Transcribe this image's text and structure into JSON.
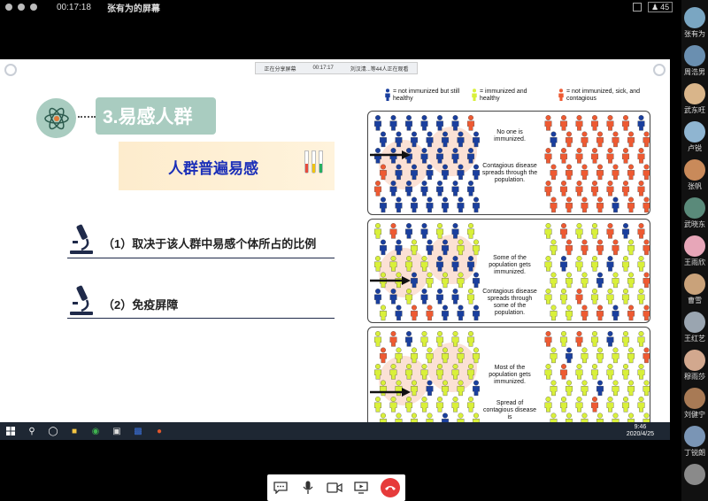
{
  "topbar": {
    "timer": "00:17:18",
    "sharer": "张有为的屏幕",
    "participant_count": "45"
  },
  "share_banner": {
    "status": "正在分享屏幕",
    "time": "00:17:17",
    "viewers": "刘汉清...等44人正在观看"
  },
  "slide": {
    "title": "3.易感人群",
    "subtitle": "人群普遍易感",
    "points": [
      "（1）取决于该人群中易感个体所占的比例",
      "（2）免疫屏障"
    ],
    "figure": {
      "legend": [
        {
          "text": "= not immunized but still healthy",
          "color": "#1a3f9e"
        },
        {
          "text": "= immunized and healthy",
          "color": "#d9f03a"
        },
        {
          "text": "= not immunized, sick, and contagious",
          "color": "#ee5a32"
        }
      ],
      "panels": [
        {
          "caption_top": "No one is immunized.",
          "caption_bottom": "Contagious disease spreads through the population."
        },
        {
          "caption_top": "Some of the population gets immunized.",
          "caption_bottom": "Contagious disease spreads through some of the population."
        },
        {
          "caption_top": "Most of the population gets immunized.",
          "caption_bottom": "Spread of contagious disease is"
        }
      ]
    }
  },
  "participants": [
    {
      "name": "张有为",
      "color": "#7aa6c2"
    },
    {
      "name": "周浩男",
      "color": "#6a8fb0"
    },
    {
      "name": "武东旺",
      "color": "#d9b58a"
    },
    {
      "name": "卢锐",
      "color": "#8fb5d1"
    },
    {
      "name": "张帆",
      "color": "#c98a5a"
    },
    {
      "name": "武晓东",
      "color": "#5a8a7a"
    },
    {
      "name": "王雨欣",
      "color": "#e7a6b8"
    },
    {
      "name": "曹雪",
      "color": "#c9a27a"
    },
    {
      "name": "王红艺",
      "color": "#9aa5b0"
    },
    {
      "name": "穆雨莎",
      "color": "#d2a88e"
    },
    {
      "name": "刘健宁",
      "color": "#a87a55"
    },
    {
      "name": "丁锐朗",
      "color": "#7a95b5"
    },
    {
      "name": "",
      "color": "#8a8a8a"
    }
  ],
  "taskbar": {
    "time": "9:46",
    "date": "2020/4/25"
  },
  "colors": {
    "healthy": "#1a3f9e",
    "immunized": "#d9f03a",
    "sick": "#ee5a32",
    "accent": "#a9ccc0",
    "subtitle": "#1b2fb8"
  }
}
